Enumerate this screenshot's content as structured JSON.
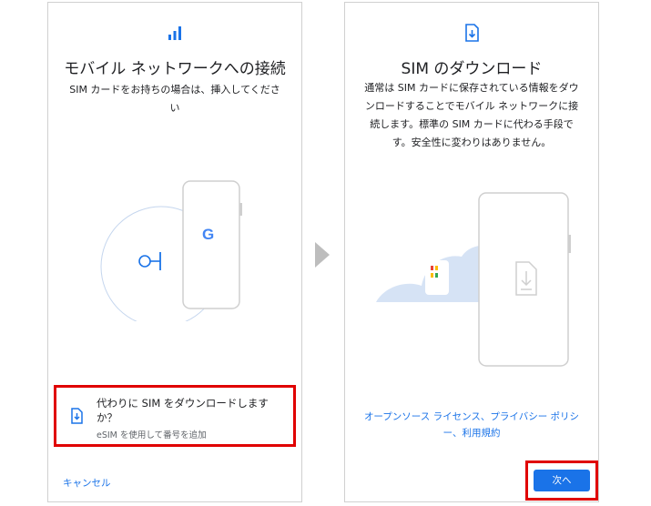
{
  "left_screen": {
    "title": "モバイル ネットワークへの接続",
    "subtitle": "SIM カードをお持ちの場合は、挿入してください",
    "google_logo": "G",
    "esim_option": {
      "main": "代わりに SIM をダウンロードしますか？",
      "sub": "eSIM を使用して番号を追加"
    },
    "cancel_label": "キャンセル"
  },
  "right_screen": {
    "title": "SIM のダウンロード",
    "subtitle": "通常は SIM カードに保存されている情報をダウンロードすることでモバイル ネットワークに接続します。標準の SIM カードに代わる手段です。安全性に変わりはありません。",
    "links": "オープンソース ライセンス、プライバシー ポリシー、利用規約",
    "next_label": "次へ"
  },
  "icons": {
    "signal": "signal-bars-icon",
    "download_sim": "download-sim-icon",
    "arrow": "next-arrow-icon"
  },
  "colors": {
    "accent": "#1a73e8",
    "highlight": "#e00000",
    "cloud": "#d6e3f5"
  }
}
